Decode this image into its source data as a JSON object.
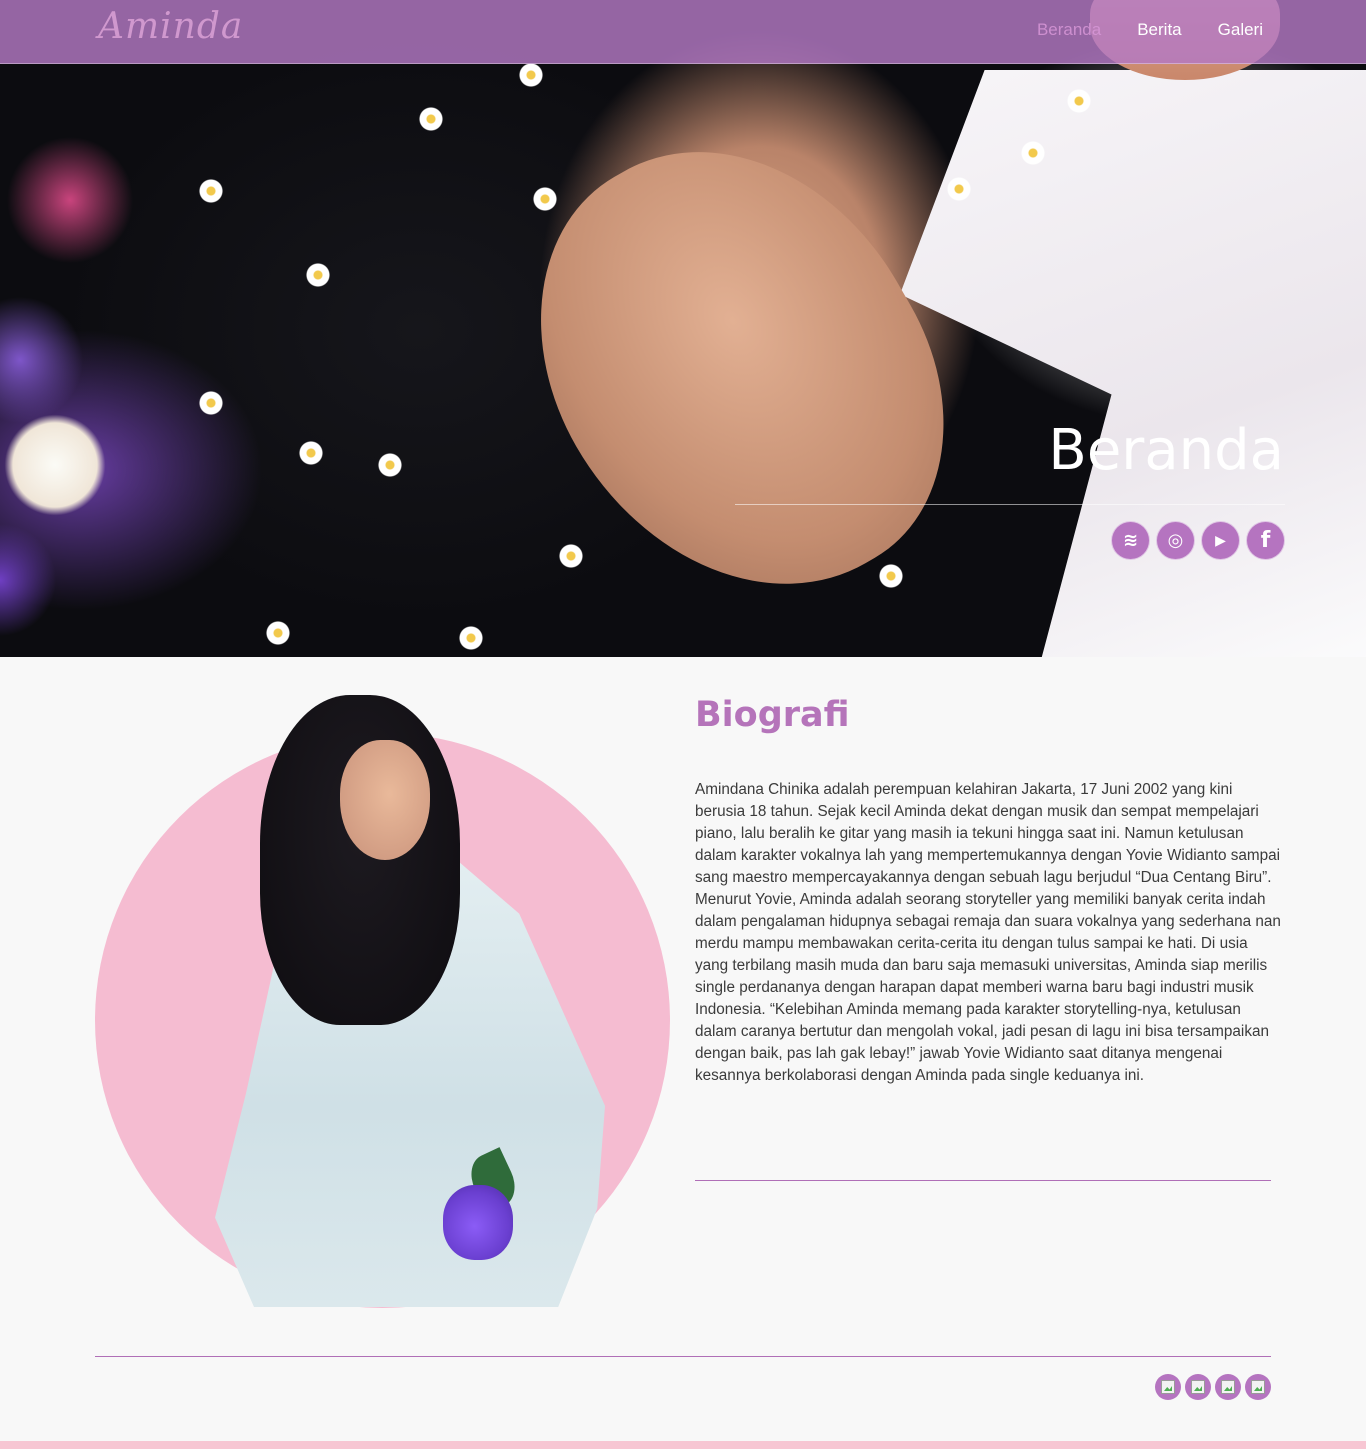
{
  "nav": {
    "logo": "Aminda",
    "links": [
      {
        "label": "Beranda",
        "active": true
      },
      {
        "label": "Berita",
        "active": false
      },
      {
        "label": "Galeri",
        "active": false
      }
    ]
  },
  "hero": {
    "title": "Beranda",
    "social": [
      {
        "icon": "spotify-icon",
        "glyph": "≋"
      },
      {
        "icon": "instagram-icon",
        "glyph": "◎"
      },
      {
        "icon": "youtube-icon",
        "glyph": "▶"
      },
      {
        "icon": "facebook-icon",
        "glyph": "f"
      }
    ]
  },
  "bio": {
    "title": "Biografi",
    "text": "Amindana Chinika adalah perempuan kelahiran Jakarta, 17 Juni 2002 yang kini berusia 18 tahun. Sejak kecil Aminda dekat dengan musik dan sempat mempelajari piano, lalu beralih ke gitar yang masih ia tekuni hingga saat ini. Namun ketulusan dalam karakter vokalnya lah yang mempertemukannya dengan Yovie Widianto sampai sang maestro mempercayakannya dengan sebuah lagu berjudul “Dua Centang Biru”. Menurut Yovie, Aminda adalah seorang storyteller yang memiliki banyak cerita indah dalam pengalaman hidupnya sebagai remaja dan suara vokalnya yang sederhana nan merdu mampu membawakan cerita-cerita itu dengan tulus sampai ke hati. Di usia yang terbilang masih muda dan baru saja memasuki universitas, Aminda siap merilis single perdananya dengan harapan dapat memberi warna baru bagi industri musik Indonesia. “Kelebihan Aminda memang pada karakter storytelling-nya, ketulusan dalam caranya bertutur dan mengolah vokal, jadi pesan di lagu ini bisa tersampaikan dengan baik, pas lah gak lebay!” jawab Yovie Widianto saat ditanya mengenai kesannya berkolaborasi dengan Aminda pada single keduanya ini."
  },
  "footer": {
    "icons": [
      "broken-image-icon",
      "broken-image-icon",
      "broken-image-icon",
      "broken-image-icon"
    ]
  },
  "colors": {
    "accent": "#b574ba",
    "navbar": "#b379c4",
    "photo_circle": "#f5bcd1"
  }
}
